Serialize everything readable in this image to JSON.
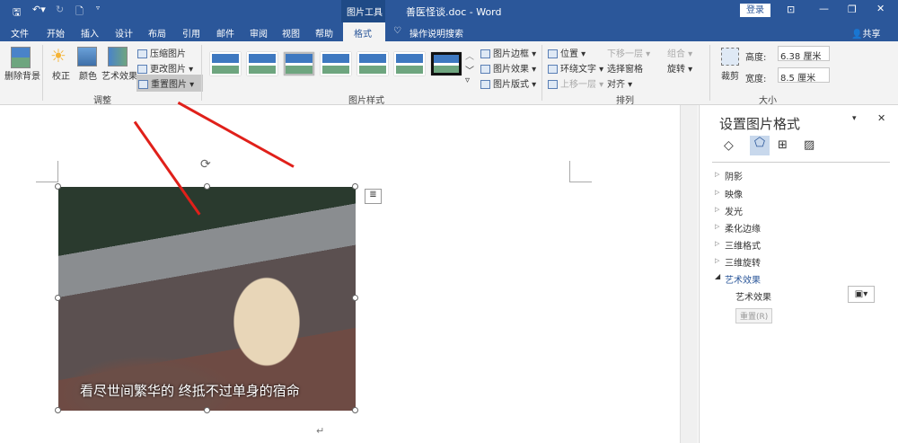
{
  "title_bar": {
    "qat": [
      "save",
      "undo",
      "redo",
      "new",
      "customize"
    ],
    "context_tab": "图片工具",
    "doc_title": "善医怪谈.doc  -  Word",
    "login": "登录"
  },
  "tabs": [
    "文件",
    "开始",
    "插入",
    "设计",
    "布局",
    "引用",
    "邮件",
    "审阅",
    "视图",
    "帮助",
    "格式"
  ],
  "active_tab": "格式",
  "search": "操作说明搜索",
  "share": "共享",
  "ribbon": {
    "adjust": {
      "remove_bg": "删除背景",
      "correct": "校正",
      "color": "颜色",
      "art": "艺术效果",
      "compress": "压缩图片",
      "change": "更改图片",
      "reset": "重置图片",
      "group": "调整"
    },
    "styles": {
      "border": "图片边框",
      "effects": "图片效果",
      "layout": "图片版式",
      "group": "图片样式"
    },
    "arrange": {
      "position": "位置",
      "wrap": "环绕文字",
      "forward": "上移一层",
      "backward": "下移一层",
      "pane": "选择窗格",
      "align": "对齐",
      "group_btn": "组合",
      "rotate": "旋转",
      "group": "排列"
    },
    "size": {
      "crop": "裁剪",
      "height_label": "高度:",
      "height": "6.38 厘米",
      "width_label": "宽度:",
      "width": "8.5 厘米",
      "group": "大小"
    }
  },
  "image": {
    "caption": "看尽世间繁华的 终抵不过单身的宿命"
  },
  "panel": {
    "title": "设置图片格式",
    "items": [
      "阴影",
      "映像",
      "发光",
      "柔化边缘",
      "三维格式",
      "三维旋转"
    ],
    "expanded": "艺术效果",
    "art_label": "艺术效果",
    "reset": "重置(R)"
  },
  "colors": {
    "accent": "#2b579a",
    "arrow": "#e0201a"
  }
}
